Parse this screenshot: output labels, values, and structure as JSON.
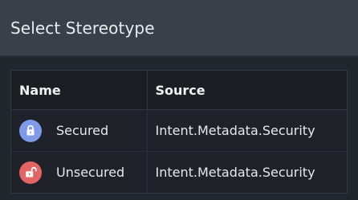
{
  "dialog": {
    "title": "Select Stereotype"
  },
  "table": {
    "columns": {
      "name": "Name",
      "source": "Source"
    },
    "rows": [
      {
        "name": "Secured",
        "source": "Intent.Metadata.Security",
        "icon": "lock-closed-icon",
        "icon_color": "#7e9ae8"
      },
      {
        "name": "Unsecured",
        "source": "Intent.Metadata.Security",
        "icon": "lock-open-icon",
        "icon_color": "#e36464"
      }
    ]
  }
}
